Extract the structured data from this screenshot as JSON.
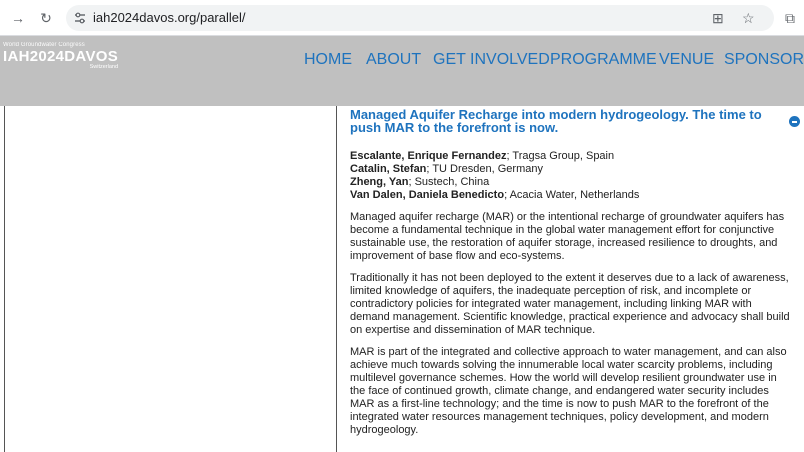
{
  "browser": {
    "url": "iah2024davos.org/parallel/"
  },
  "logo": {
    "top_line": "World Groundwater Congress",
    "main": "IAH2024DAVOS",
    "sub": "Switzerland"
  },
  "nav": {
    "items": [
      "HOME",
      "ABOUT",
      "GET INVOLVED",
      "PROGRAMME",
      "VENUE",
      "SPONSORS"
    ]
  },
  "abstract": {
    "title": "Managed Aquifer Recharge into modern hydrogeology. The time to push MAR to the forefront is now.",
    "authors": [
      {
        "name": "Escalante, Enrique Fernandez",
        "affiliation": "; Tragsa Group, Spain"
      },
      {
        "name": "Catalin, Stefan",
        "affiliation": "; TU Dresden, Germany"
      },
      {
        "name": "Zheng, Yan",
        "affiliation": "; Sustech, China"
      },
      {
        "name": "Van Dalen, Daniela Benedicto",
        "affiliation": "; Acacia Water, Netherlands"
      }
    ],
    "paragraphs": [
      "Managed aquifer recharge (MAR) or the intentional recharge of groundwater aquifers has become a fundamental technique in the global water management effort for conjunctive sustainable use, the restoration of aquifer storage, increased resilience to droughts, and improvement of base flow and eco-systems.",
      "Traditionally it has not been deployed to the extent it deserves due to a lack of awareness, limited knowledge of aquifers, the inadequate perception of risk, and incomplete or contradictory policies for integrated water management, including linking MAR with demand management. Scientific knowledge, practical experience and advocacy shall build on expertise and dissemination of MAR technique.",
      "MAR is part of the integrated and collective approach to water management, and can also achieve much towards solving the innumerable local water scarcity problems, including multilevel governance schemes. How the world will develop resilient groundwater use in the face of continued growth, climate change, and endangered water security includes MAR as a first-line technology; and the time is now to push MAR to the forefront of the integrated water resources management techniques, policy development, and modern hydrogeology."
    ]
  }
}
